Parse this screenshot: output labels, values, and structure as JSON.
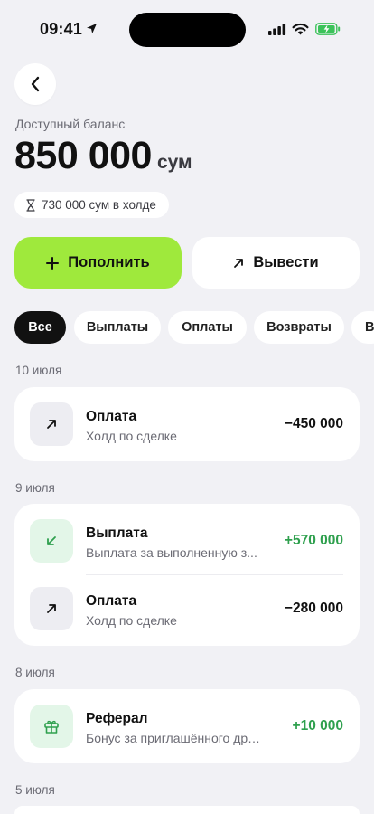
{
  "status_bar": {
    "time": "09:41"
  },
  "balance": {
    "label": "Доступный баланс",
    "amount": "850 000",
    "currency": "сум",
    "hold": "730 000 сум в холде"
  },
  "actions": {
    "topup": "Пополнить",
    "withdraw": "Вывести"
  },
  "filters": [
    "Все",
    "Выплаты",
    "Оплаты",
    "Возвраты",
    "В"
  ],
  "active_filter": "Все",
  "groups": [
    {
      "date": "10 июля",
      "items": [
        {
          "title": "Оплата",
          "subtitle": "Холд по сделке",
          "amount": "−450 000",
          "icon": "arrow-up-right-icon"
        }
      ]
    },
    {
      "date": "9 июля",
      "items": [
        {
          "title": "Выплата",
          "subtitle": "Выплата за выполненную з...",
          "amount": "+570 000",
          "icon": "arrow-down-left-icon"
        },
        {
          "title": "Оплата",
          "subtitle": "Холд по сделке",
          "amount": "−280 000",
          "icon": "arrow-up-right-icon"
        }
      ]
    },
    {
      "date": "8 июля",
      "items": [
        {
          "title": "Реферал",
          "subtitle": "Бонус за приглашённого друга",
          "amount": "+10 000",
          "icon": "gift-icon"
        }
      ]
    },
    {
      "date": "5 июля",
      "items": []
    }
  ],
  "colors": {
    "accent": "#9fe93c",
    "positive": "#2fa04e",
    "background": "#f1f1f5"
  }
}
